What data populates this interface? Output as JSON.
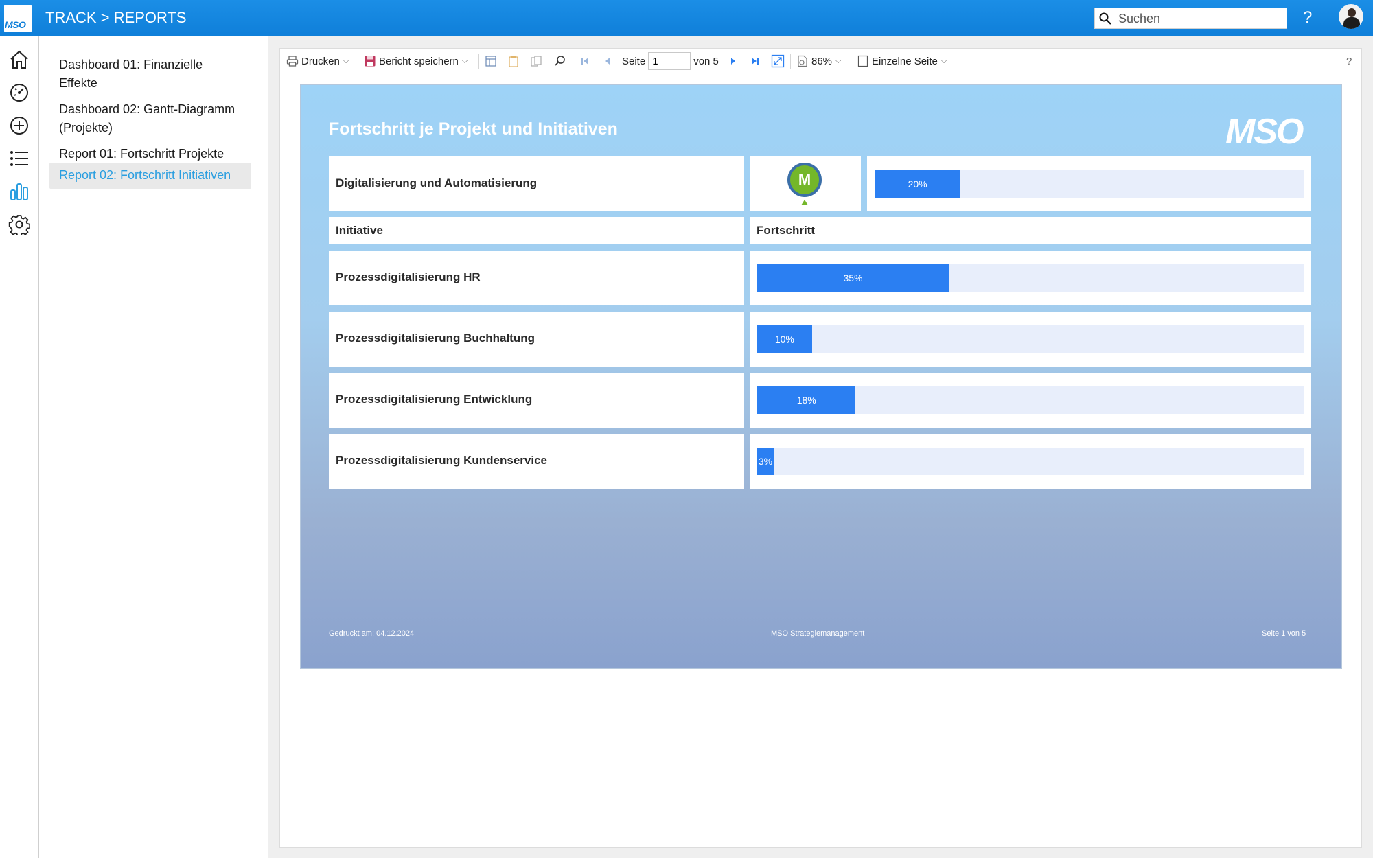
{
  "header": {
    "logo_text": "MSO",
    "title": "TRACK > REPORTS",
    "search_placeholder": "Suchen",
    "help_label": "?"
  },
  "rail": {
    "icons": [
      "home-icon",
      "dashboard-gauge-icon",
      "add-circle-icon",
      "list-icon",
      "bar-chart-icon",
      "settings-gear-icon"
    ],
    "active_icon": "bar-chart-icon",
    "active_color": "#2a9ee0"
  },
  "sidebar": {
    "items": [
      {
        "label": "Dashboard 01: Finanzielle Effekte"
      },
      {
        "label": "Dashboard 02: Gantt-Diagramm (Projekte)"
      },
      {
        "label": "Report 01: Fortschritt Projekte"
      },
      {
        "label": "Report 02: Fortschritt Initiativen"
      }
    ],
    "active_index": 3
  },
  "toolbar": {
    "print_label": "Drucken",
    "save_label": "Bericht speichern",
    "page_label": "Seite",
    "page_value": "1",
    "page_of": "von 5",
    "zoom": "86%",
    "view_mode": "Einzelne Seite",
    "help_label": "?"
  },
  "report": {
    "title": "Fortschritt je Projekt und Initiativen",
    "logo_text": "MSO",
    "project": {
      "name": "Digitalisierung und Automatisierung",
      "status_letter": "M",
      "progress": 20,
      "progress_label": "20%"
    },
    "columns": {
      "initiative": "Initiative",
      "progress": "Fortschritt"
    },
    "initiatives": [
      {
        "name": "Prozessdigitalisierung HR",
        "progress": 35,
        "label": "35%"
      },
      {
        "name": "Prozessdigitalisierung Buchhaltung",
        "progress": 10,
        "label": "10%"
      },
      {
        "name": "Prozessdigitalisierung Entwicklung",
        "progress": 18,
        "label": "18%"
      },
      {
        "name": "Prozessdigitalisierung Kundenservice",
        "progress": 3,
        "label": "3%"
      }
    ],
    "footer": {
      "printed": "Gedruckt am: 04.12.2024",
      "company": "MSO Strategiemanagement",
      "page": "Seite 1 von 5"
    }
  },
  "colors": {
    "header_blue": "#1b8ee6",
    "bar_blue": "#2b7ff2",
    "status_green": "#74b72a",
    "active_nav_text": "#2a9ee0"
  }
}
